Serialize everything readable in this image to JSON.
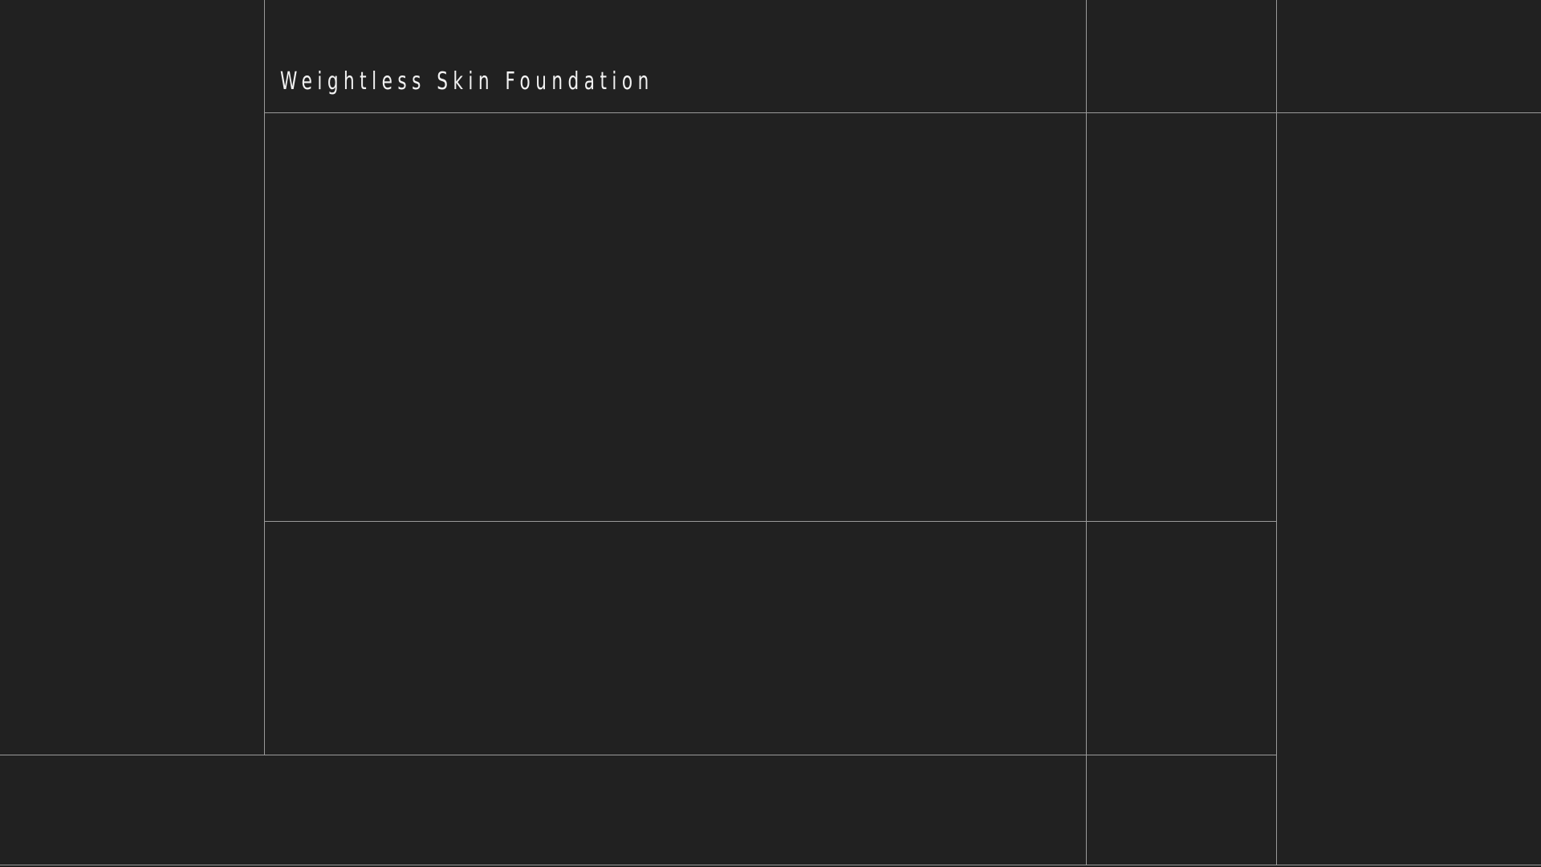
{
  "page": {
    "title": "Weightless Skin Foundation",
    "background_color": "#212121",
    "line_color": "#9a9a9a",
    "text_color": "#f2f2f2"
  }
}
